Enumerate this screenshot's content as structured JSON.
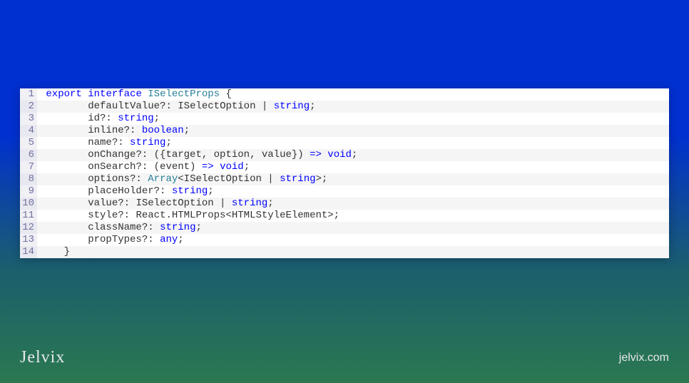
{
  "brand": "Jelvix",
  "url": "jelvix.com",
  "code": {
    "lines": [
      {
        "num": "1",
        "segments": [
          {
            "t": " ",
            "c": ""
          },
          {
            "t": "export",
            "c": "kw"
          },
          {
            "t": " ",
            "c": ""
          },
          {
            "t": "interface",
            "c": "kw"
          },
          {
            "t": " ",
            "c": ""
          },
          {
            "t": "ISelectProps",
            "c": "typ"
          },
          {
            "t": " {",
            "c": ""
          }
        ]
      },
      {
        "num": "2",
        "segments": [
          {
            "t": "        ",
            "c": ""
          },
          {
            "t": "defaultValue",
            "c": ""
          },
          {
            "t": "?: ",
            "c": ""
          },
          {
            "t": "ISelectOption",
            "c": ""
          },
          {
            "t": " | ",
            "c": ""
          },
          {
            "t": "string",
            "c": "str-typ"
          },
          {
            "t": ";",
            "c": ""
          }
        ]
      },
      {
        "num": "3",
        "segments": [
          {
            "t": "        ",
            "c": ""
          },
          {
            "t": "id",
            "c": ""
          },
          {
            "t": "?: ",
            "c": ""
          },
          {
            "t": "string",
            "c": "str-typ"
          },
          {
            "t": ";",
            "c": ""
          }
        ]
      },
      {
        "num": "4",
        "segments": [
          {
            "t": "        ",
            "c": ""
          },
          {
            "t": "inline",
            "c": ""
          },
          {
            "t": "?: ",
            "c": ""
          },
          {
            "t": "boolean",
            "c": "str-typ"
          },
          {
            "t": ";",
            "c": ""
          }
        ]
      },
      {
        "num": "5",
        "segments": [
          {
            "t": "        ",
            "c": ""
          },
          {
            "t": "name",
            "c": ""
          },
          {
            "t": "?: ",
            "c": ""
          },
          {
            "t": "string",
            "c": "str-typ"
          },
          {
            "t": ";",
            "c": ""
          }
        ]
      },
      {
        "num": "6",
        "segments": [
          {
            "t": "        ",
            "c": ""
          },
          {
            "t": "onChange",
            "c": ""
          },
          {
            "t": "?: ({target, option, value}) ",
            "c": ""
          },
          {
            "t": "=>",
            "c": "str-typ"
          },
          {
            "t": " ",
            "c": ""
          },
          {
            "t": "void",
            "c": "str-typ"
          },
          {
            "t": ";",
            "c": ""
          }
        ]
      },
      {
        "num": "7",
        "segments": [
          {
            "t": "        ",
            "c": ""
          },
          {
            "t": "onSearch",
            "c": ""
          },
          {
            "t": "?: (event) ",
            "c": ""
          },
          {
            "t": "=>",
            "c": "str-typ"
          },
          {
            "t": " ",
            "c": ""
          },
          {
            "t": "void",
            "c": "str-typ"
          },
          {
            "t": ";",
            "c": ""
          }
        ]
      },
      {
        "num": "8",
        "segments": [
          {
            "t": "        ",
            "c": ""
          },
          {
            "t": "options",
            "c": ""
          },
          {
            "t": "?: ",
            "c": ""
          },
          {
            "t": "Array",
            "c": "typ"
          },
          {
            "t": "<ISelectOption | ",
            "c": ""
          },
          {
            "t": "string",
            "c": "str-typ"
          },
          {
            "t": ">;",
            "c": ""
          }
        ]
      },
      {
        "num": "9",
        "segments": [
          {
            "t": "        ",
            "c": ""
          },
          {
            "t": "placeHolder",
            "c": ""
          },
          {
            "t": "?: ",
            "c": ""
          },
          {
            "t": "string",
            "c": "str-typ"
          },
          {
            "t": ";",
            "c": ""
          }
        ]
      },
      {
        "num": "10",
        "segments": [
          {
            "t": "        ",
            "c": ""
          },
          {
            "t": "value",
            "c": ""
          },
          {
            "t": "?: ISelectOption | ",
            "c": ""
          },
          {
            "t": "string",
            "c": "str-typ"
          },
          {
            "t": ";",
            "c": ""
          }
        ]
      },
      {
        "num": "11",
        "segments": [
          {
            "t": "        ",
            "c": ""
          },
          {
            "t": "style",
            "c": ""
          },
          {
            "t": "?: React.HTMLProps<HTMLStyleElement>;",
            "c": ""
          }
        ]
      },
      {
        "num": "12",
        "segments": [
          {
            "t": "        ",
            "c": ""
          },
          {
            "t": "className",
            "c": ""
          },
          {
            "t": "?: ",
            "c": ""
          },
          {
            "t": "string",
            "c": "str-typ"
          },
          {
            "t": ";",
            "c": ""
          }
        ]
      },
      {
        "num": "13",
        "segments": [
          {
            "t": "        ",
            "c": ""
          },
          {
            "t": "propTypes",
            "c": ""
          },
          {
            "t": "?: ",
            "c": ""
          },
          {
            "t": "any",
            "c": "str-typ"
          },
          {
            "t": ";",
            "c": ""
          }
        ]
      },
      {
        "num": "14",
        "segments": [
          {
            "t": "    }",
            "c": ""
          }
        ]
      }
    ]
  }
}
